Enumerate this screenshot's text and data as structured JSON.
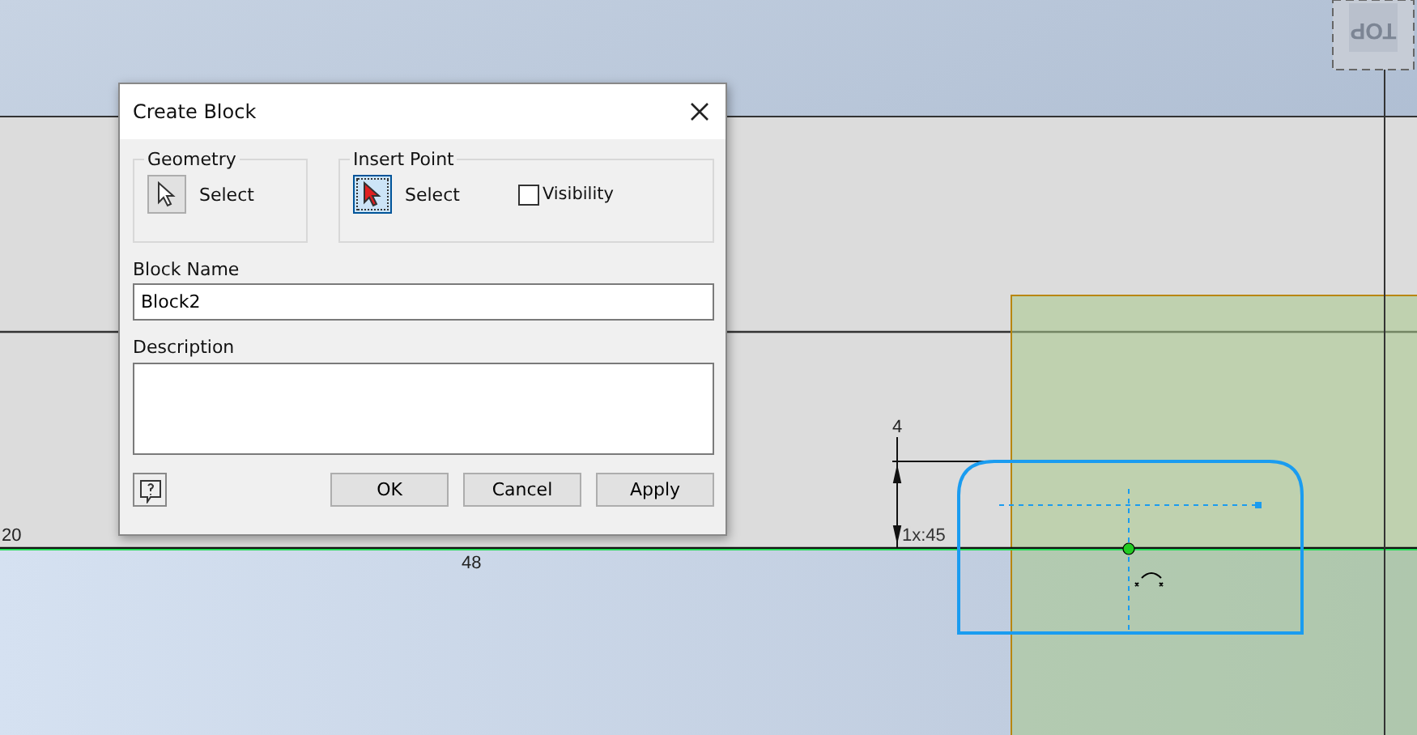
{
  "canvas": {
    "view_cube_label": "TOP",
    "dimension_labels": [
      "20",
      "48"
    ],
    "vertical_dimension": "4",
    "chamfer_label": "1x:45"
  },
  "dialog": {
    "title": "Create Block",
    "geometry": {
      "label": "Geometry",
      "select": "Select",
      "selected": false
    },
    "insert_point": {
      "label": "Insert Point",
      "select": "Select",
      "selected": true,
      "visibility": {
        "label": "Visibility",
        "checked": false
      }
    },
    "block_name": {
      "label": "Block Name",
      "value": "Block2"
    },
    "description": {
      "label": "Description"
    },
    "buttons": [
      "OK",
      "Cancel",
      "Apply"
    ]
  }
}
